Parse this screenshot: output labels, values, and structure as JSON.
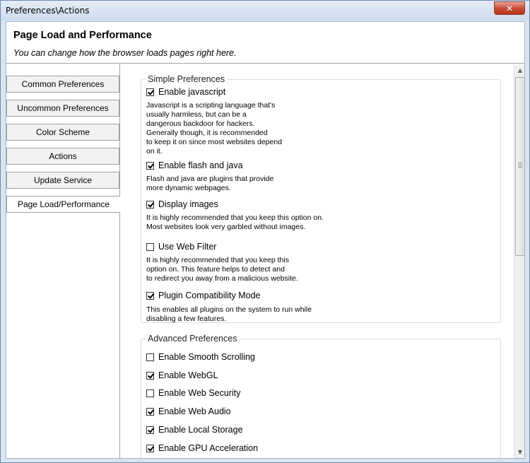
{
  "window": {
    "title": "Preferences\\Actions",
    "close_glyph": "✕"
  },
  "header": {
    "title": "Page Load and Performance",
    "subtitle": "You can change how the browser loads pages right here."
  },
  "tabs": [
    {
      "label": "Common Preferences",
      "active": false
    },
    {
      "label": "Uncommon Preferences",
      "active": false
    },
    {
      "label": "Color Scheme",
      "active": false
    },
    {
      "label": "Actions",
      "active": false
    },
    {
      "label": "Update Service",
      "active": false
    },
    {
      "label": "Page Load/Performance",
      "active": true
    }
  ],
  "simple": {
    "legend": "Simple Preferences",
    "items": [
      {
        "label": "Enable javascript",
        "checked": true,
        "desc": "Javascript is a scripting language that's\nusually harmless, but can be a\ndangerous backdoor for hackers.\nGenerally though, it is recommended\nto keep it on since most websites depend\non it."
      },
      {
        "label": "Enable flash and java",
        "checked": true,
        "desc": "Flash and java are plugins that provide\nmore dynamic webpages."
      },
      {
        "label": "Display images",
        "checked": true,
        "desc": "It is highly recommended that you keep this option on.\nMost websites look very garbled without images."
      },
      {
        "label": "Use Web Filter",
        "checked": false,
        "desc": "It is highly recommended that you keep this\noption on. This feature helps to detect and\nto redirect you away from a malicious website."
      },
      {
        "label": "Plugin Compatibility Mode",
        "checked": true,
        "desc": "This enables all plugins on the system to run while\ndisabling a few features."
      }
    ]
  },
  "advanced": {
    "legend": "Advanced Preferences",
    "items": [
      {
        "label": "Enable Smooth Scrolling",
        "checked": false
      },
      {
        "label": "Enable WebGL",
        "checked": true
      },
      {
        "label": "Enable Web Security",
        "checked": false
      },
      {
        "label": "Enable Web Audio",
        "checked": true
      },
      {
        "label": "Enable Local Storage",
        "checked": true
      },
      {
        "label": "Enable GPU Acceleration",
        "checked": true
      }
    ]
  },
  "scrollbar": {
    "up_glyph": "▲",
    "down_glyph": "▼"
  }
}
